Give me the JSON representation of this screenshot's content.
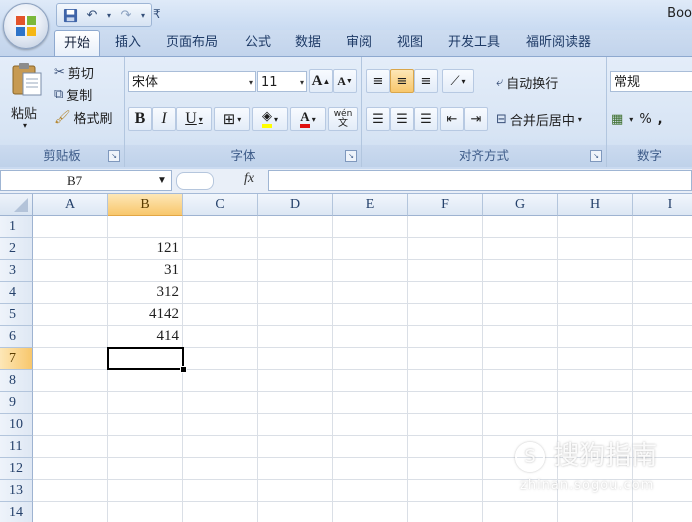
{
  "title": "Boo",
  "colors": {
    "accent": "#f8c76c",
    "ribbon": "#d7e4f4",
    "tab_text": "#1e3a66"
  },
  "qat": {
    "save_icon": "save-icon",
    "undo_icon": "undo-icon",
    "redo_icon": "redo-icon",
    "customize_icon": "customize-qat-icon"
  },
  "tabs": [
    {
      "label": "开始",
      "active": true
    },
    {
      "label": "插入"
    },
    {
      "label": "页面布局"
    },
    {
      "label": "公式"
    },
    {
      "label": "数据"
    },
    {
      "label": "审阅"
    },
    {
      "label": "视图"
    },
    {
      "label": "开发工具"
    },
    {
      "label": "福昕阅读器"
    }
  ],
  "clipboard": {
    "paste": "粘贴",
    "cut": "剪切",
    "copy": "复制",
    "format_painter": "格式刷",
    "label": "剪贴板"
  },
  "font": {
    "name": "宋体",
    "size": "11",
    "grow": "A",
    "shrink": "A",
    "bold": "B",
    "italic": "I",
    "underline": "U",
    "phonetic": "wén",
    "label": "字体"
  },
  "alignment": {
    "wrap": "自动换行",
    "merge": "合并后居中",
    "label": "对齐方式"
  },
  "number": {
    "format": "常规",
    "percent": "%",
    "comma": ",",
    "label": "数字"
  },
  "formula_bar": {
    "name_box": "B7",
    "fx": "fx",
    "value": ""
  },
  "columns": [
    "A",
    "B",
    "C",
    "D",
    "E",
    "F",
    "G",
    "H",
    "I"
  ],
  "selected_column": "B",
  "rows": [
    "1",
    "2",
    "3",
    "4",
    "5",
    "6",
    "7",
    "8",
    "9",
    "10",
    "11",
    "12",
    "13",
    "14"
  ],
  "selected_row": "7",
  "cells": {
    "B2": "121",
    "B3": "31",
    "B4": "312",
    "B5": "4142",
    "B6": "414"
  },
  "watermark": {
    "brand": "搜狗指南",
    "url": "zhinan.sogou.com"
  }
}
